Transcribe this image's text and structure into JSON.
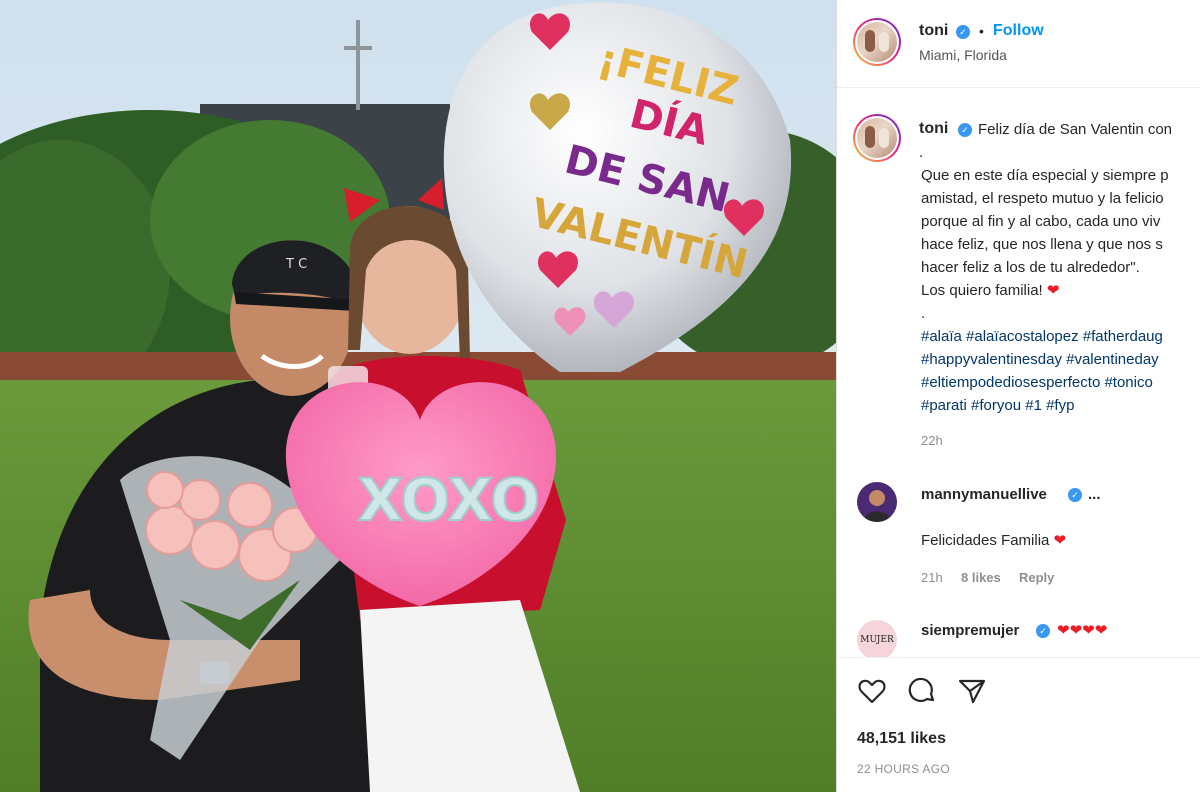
{
  "post": {
    "author": {
      "username": "toni",
      "verified_mark": "✓",
      "follow_label": "Follow",
      "separator": "•",
      "location": "Miami, Florida"
    },
    "photo": {
      "balloon_lines": [
        "¡FELIZ",
        "DÍA",
        "DE SAN",
        "VALENTÍN"
      ],
      "pillow_text": "XOXO",
      "cap_logo": "T C"
    },
    "caption": {
      "username": "toni",
      "lines": [
        "Feliz día de San Valentin con",
        ".",
        "Que en este día especial y siempre p",
        "amistad, el respeto mutuo y la felicio",
        "porque al fin y al cabo, cada uno viv",
        "hace feliz, que nos llena y que nos s",
        "hacer feliz a los de tu alrededor\".",
        "Los quiero familia! ",
        ".",
        "#alaïa #alaïacostalopez #fatherdaug",
        "#happyvalentinesday #valentineday",
        "#eltiempodediosesperfecto #tonico",
        "#parati #foryou #1 #fyp"
      ],
      "heart": "❤",
      "time": "22h"
    },
    "comments": [
      {
        "username": "mannymanuellive",
        "more": "...",
        "text": "Felicidades Familia ",
        "heart": "❤",
        "time": "21h",
        "likes": "8 likes",
        "reply": "Reply"
      },
      {
        "username": "siempremujer",
        "avatar_text": "MUJER",
        "hearts": "❤❤❤❤"
      }
    ],
    "actions": {
      "like_icon": "heart-icon",
      "comment_icon": "comment-icon",
      "share_icon": "share-icon"
    },
    "likes": "48,151 likes",
    "posted": "22 HOURS AGO",
    "colors": {
      "follow": "#0095f6",
      "hashtag": "#00376b",
      "verified": "#3897f0",
      "heart": "#ed1c24"
    }
  }
}
